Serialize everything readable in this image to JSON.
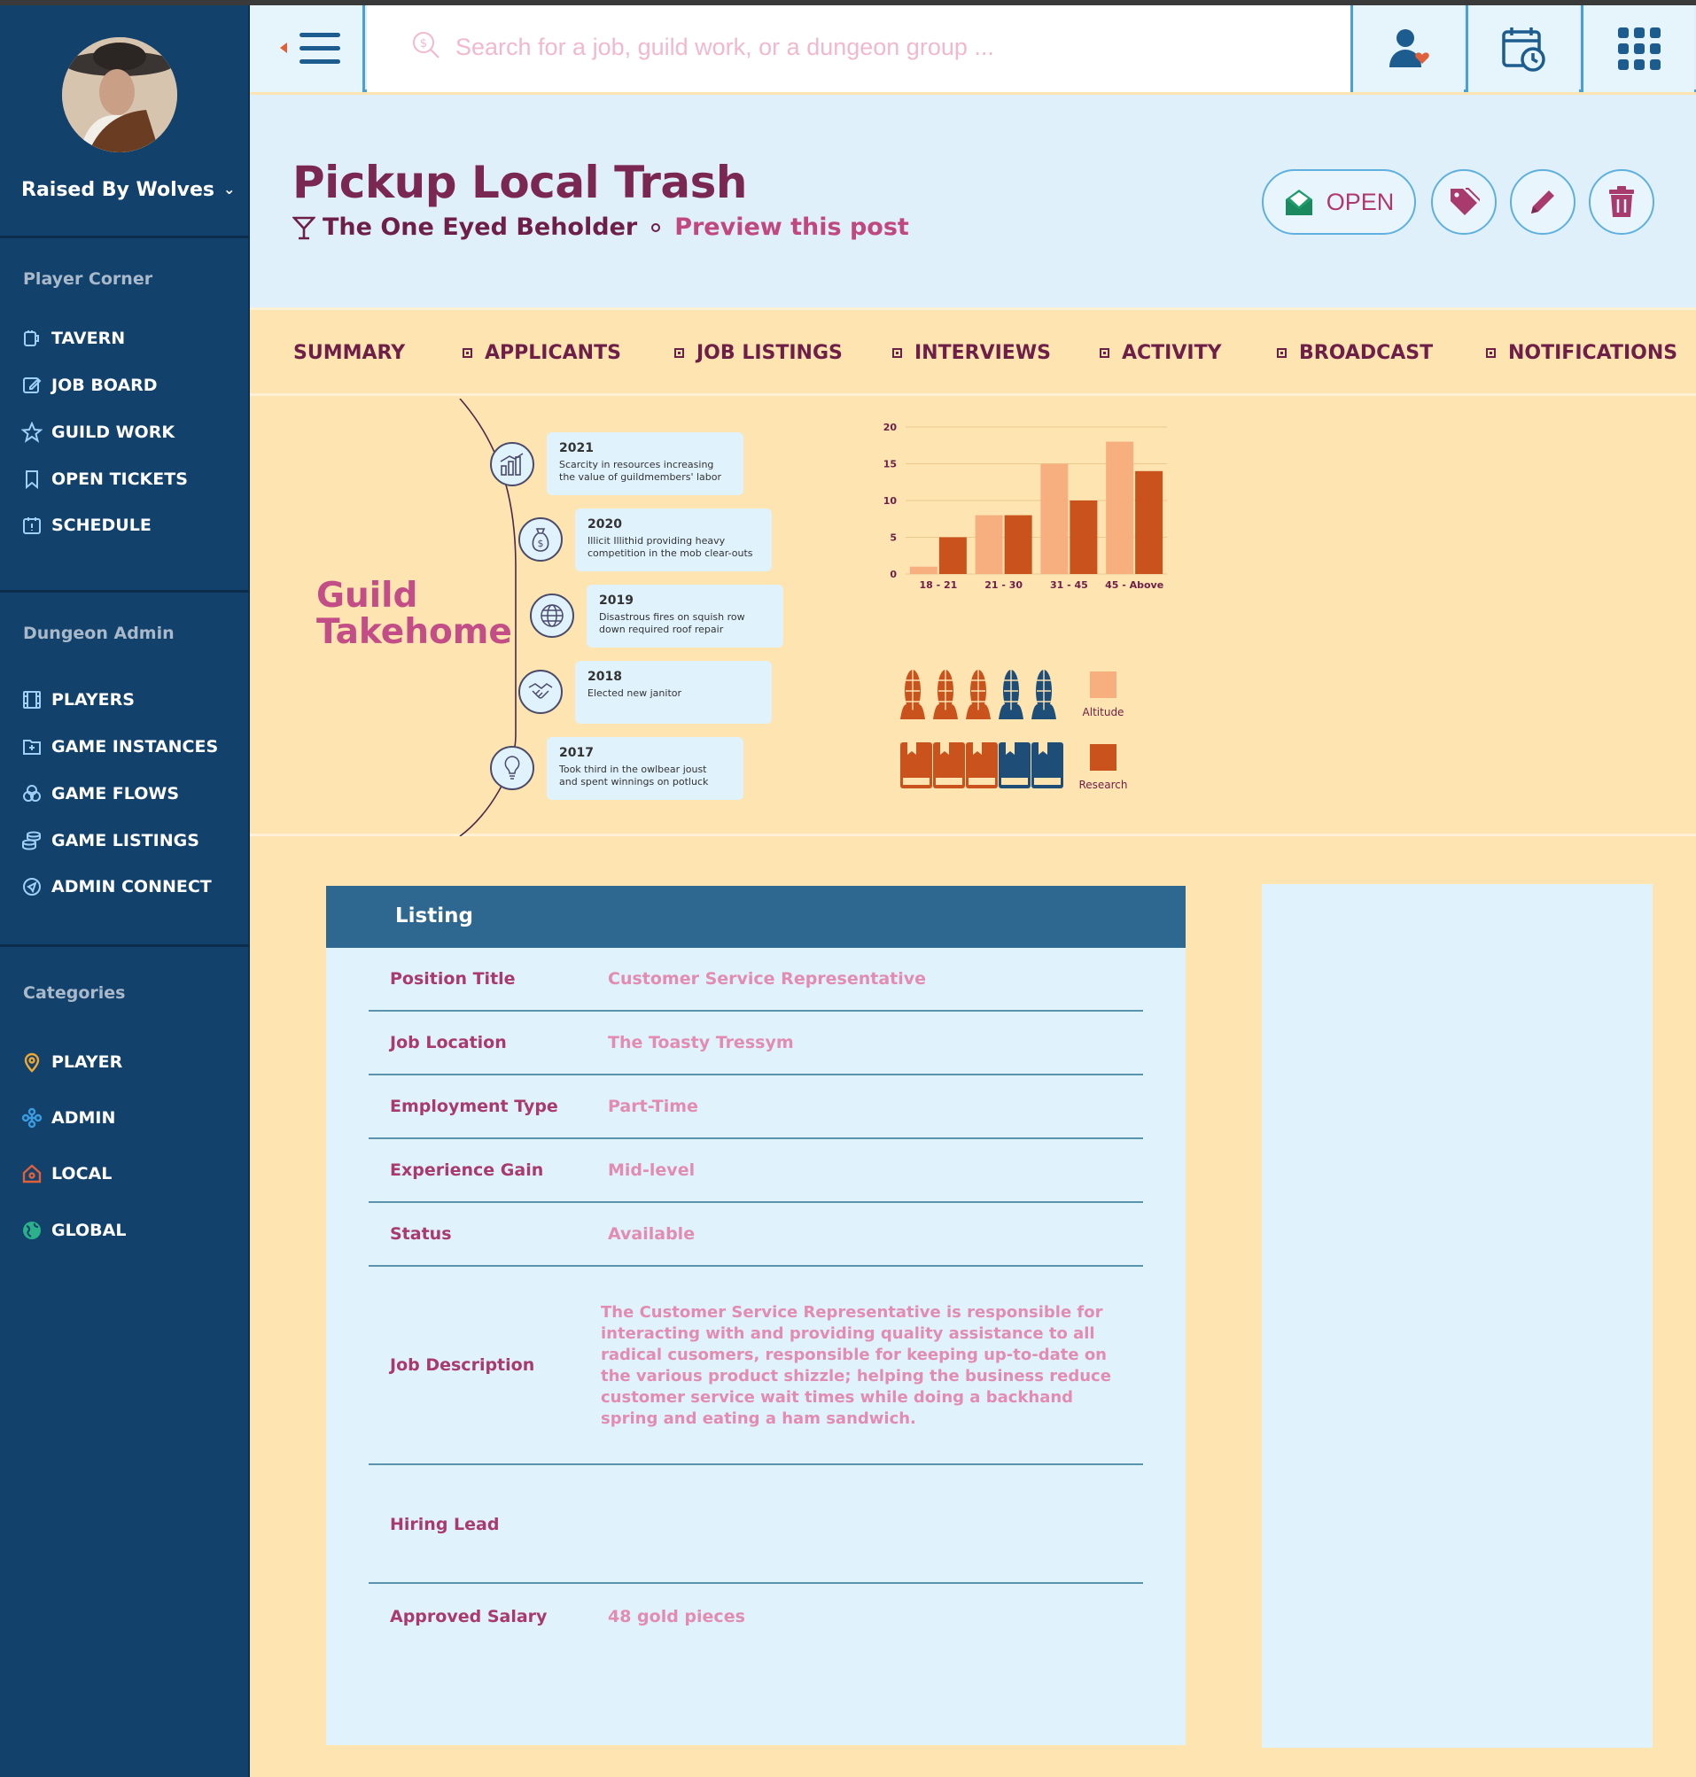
{
  "sidebar": {
    "user_name": "Raised By Wolves",
    "sections": [
      {
        "title": "Player Corner",
        "items": [
          {
            "label": "TAVERN",
            "icon": "mug-icon"
          },
          {
            "label": "JOB BOARD",
            "icon": "edit-icon"
          },
          {
            "label": "GUILD WORK",
            "icon": "star-icon"
          },
          {
            "label": "OPEN TICKETS",
            "icon": "bookmark-icon"
          },
          {
            "label": "SCHEDULE",
            "icon": "calendar-alert-icon"
          }
        ]
      },
      {
        "title": "Dungeon Admin",
        "items": [
          {
            "label": "PLAYERS",
            "icon": "film-icon"
          },
          {
            "label": "GAME INSTANCES",
            "icon": "folder-plus-icon"
          },
          {
            "label": "GAME FLOWS",
            "icon": "circles-icon"
          },
          {
            "label": "GAME LISTINGS",
            "icon": "coins-icon"
          },
          {
            "label": "ADMIN CONNECT",
            "icon": "send-circle-icon"
          }
        ]
      },
      {
        "title": "Categories",
        "items": [
          {
            "label": "PLAYER",
            "icon": "pin-icon",
            "color": "#f0a830"
          },
          {
            "label": "ADMIN",
            "icon": "network-icon",
            "color": "#3b9be0"
          },
          {
            "label": "LOCAL",
            "icon": "home-pin-icon",
            "color": "#e0603a"
          },
          {
            "label": "GLOBAL",
            "icon": "globe-icon",
            "color": "#2bb08a"
          }
        ]
      }
    ]
  },
  "topbar": {
    "search_placeholder": "Search for a job, guild work, or a dungeon group ...",
    "icons": [
      "menu-icon",
      "user-heart-icon",
      "calendar-clock-icon",
      "grid-icon"
    ]
  },
  "header": {
    "title": "Pickup Local Trash",
    "company": "The One Eyed Beholder",
    "preview_link": "Preview this post",
    "status_label": "OPEN"
  },
  "tabs": [
    "SUMMARY",
    "APPLICANTS",
    "JOB LISTINGS",
    "INTERVIEWS",
    "ACTIVITY",
    "BROADCAST",
    "NOTIFICATIONS"
  ],
  "infographic": {
    "heading_line1": "Guild",
    "heading_line2": "Takehome",
    "timeline": [
      {
        "year": "2021",
        "text1": "Scarcity in resources increasing",
        "text2": "the value of guildmembers' labor",
        "icon": "chart-icon"
      },
      {
        "year": "2020",
        "text1": "Illicit Illithid providing heavy",
        "text2": "competition in the mob clear-outs",
        "icon": "money-bag-icon"
      },
      {
        "year": "2019",
        "text1": "Disastrous fires on squish row",
        "text2": "down required roof repair",
        "icon": "globe-icon"
      },
      {
        "year": "2018",
        "text1": "Elected new janitor",
        "text2": "",
        "icon": "handshake-icon"
      },
      {
        "year": "2017",
        "text1": "Took third in the owlbear joust",
        "text2": "and spent winnings on potluck",
        "icon": "lightbulb-icon"
      }
    ],
    "legend": [
      {
        "label": "Altitude",
        "color": "#f8af80"
      },
      {
        "label": "Research",
        "color": "#ca521c"
      }
    ]
  },
  "chart_data": {
    "type": "bar",
    "categories": [
      "18 - 21",
      "21 - 30",
      "31 - 45",
      "45 - Above"
    ],
    "series": [
      {
        "name": "Altitude",
        "values": [
          1,
          8,
          15,
          18
        ],
        "color": "#f8af80"
      },
      {
        "name": "Research",
        "values": [
          5,
          8,
          10,
          14
        ],
        "color": "#ca521c"
      }
    ],
    "yticks": [
      0,
      5,
      10,
      15,
      20
    ],
    "ylim": [
      0,
      20
    ],
    "grid": true,
    "legend_position": "bottom"
  },
  "listing": {
    "header": "Listing",
    "rows": [
      {
        "label": "Position Title",
        "value": "Customer Service Representative"
      },
      {
        "label": "Job Location",
        "value": "The Toasty Tressym"
      },
      {
        "label": "Employment Type",
        "value": "Part-Time"
      },
      {
        "label": "Experience Gain",
        "value": "Mid-level"
      },
      {
        "label": "Status",
        "value": "Available"
      },
      {
        "label": "Job Description",
        "value": "The Customer Service Representative is responsible for interacting with and providing quality assistance to all radical cusomers, responsible for keeping up-to-date on the various product shizzle; helping the business reduce customer service wait times while doing a backhand spring and eating a ham sandwich."
      },
      {
        "label": "Hiring Lead",
        "value": ""
      },
      {
        "label": "Approved Salary",
        "value": "48 gold pieces"
      }
    ]
  },
  "colors": {
    "sidebar_bg": "#12416c",
    "accent": "#7a2751",
    "link": "#c0487e",
    "tab_bg": "#fde4b1",
    "panel_bg": "#e0f2fc"
  }
}
